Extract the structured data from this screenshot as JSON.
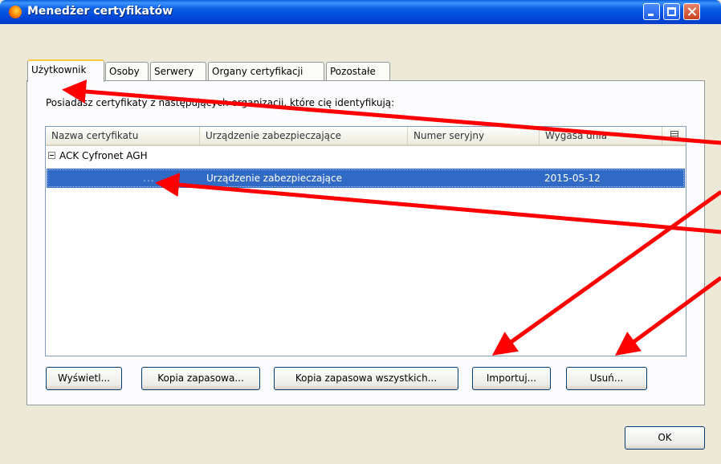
{
  "window": {
    "title": "Menedżer certyfikatów",
    "controls": [
      "minimize",
      "maximize",
      "close"
    ]
  },
  "tabs": [
    {
      "label": "Użytkownik",
      "active": true
    },
    {
      "label": "Osoby",
      "active": false
    },
    {
      "label": "Serwery",
      "active": false
    },
    {
      "label": "Organy certyfikacji",
      "active": false
    },
    {
      "label": "Pozostałe",
      "active": false
    }
  ],
  "panel": {
    "intro": "Posiadasz certyfikaty z następujących organizacji, które cię identyfikują:"
  },
  "table": {
    "columns": [
      "Nazwa certyfikatu",
      "Urządzenie zabezpieczające",
      "Numer seryjny",
      "Wygasa dnia"
    ],
    "groups": [
      {
        "label": "ACK Cyfronet AGH",
        "expanded": true,
        "rows": [
          {
            "name": "               ...",
            "device": "Urządzenie zabezpieczające",
            "serial": "            ",
            "expires": "2015-05-12",
            "selected": true
          }
        ]
      }
    ]
  },
  "buttons": {
    "view": "Wyświetl...",
    "backup": "Kopia zapasowa...",
    "backup_all": "Kopia zapasowa wszystkich...",
    "import": "Importuj...",
    "delete": "Usuń...",
    "ok": "OK"
  },
  "colors": {
    "titlebar": "#0054e3",
    "selection": "#316ac5",
    "annotation_arrow": "#ff0000"
  }
}
